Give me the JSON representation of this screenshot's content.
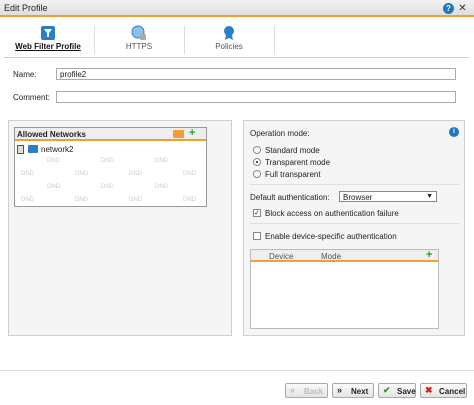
{
  "window": {
    "title": "Edit Profile",
    "help_icon": "help-icon",
    "close_icon": "close-icon"
  },
  "tabs": [
    {
      "label": "Web Filter Profile",
      "icon": "filter-icon",
      "active": true
    },
    {
      "label": "HTTPS",
      "icon": "globe-lock-icon",
      "active": false
    },
    {
      "label": "Policies",
      "icon": "policy-ribbon-icon",
      "active": false
    }
  ],
  "form": {
    "name_label": "Name:",
    "name_value": "profile2",
    "comment_label": "Comment:",
    "comment_value": ""
  },
  "allowed_networks": {
    "title": "Allowed Networks",
    "items": [
      {
        "name": "network2"
      }
    ],
    "drop_hint": "DND"
  },
  "settings": {
    "operation_mode_label": "Operation mode:",
    "modes": [
      {
        "label": "Standard mode",
        "selected": false
      },
      {
        "label": "Transparent mode",
        "selected": true
      },
      {
        "label": "Full transparent",
        "selected": false
      }
    ],
    "default_auth_label": "Default authentication:",
    "default_auth_value": "Browser",
    "block_access_label": "Block access on authentication failure",
    "block_access_checked": true,
    "device_auth_label": "Enable device-specific authentication",
    "device_auth_checked": false,
    "device_columns": [
      "Device",
      "Mode"
    ]
  },
  "buttons": {
    "back": "Back",
    "next": "Next",
    "save": "Save",
    "cancel": "Cancel"
  },
  "colors": {
    "accent": "#f0a030",
    "add_green": "#2e9a2e",
    "info_blue": "#1e77c2",
    "cancel_red": "#cc2222"
  }
}
